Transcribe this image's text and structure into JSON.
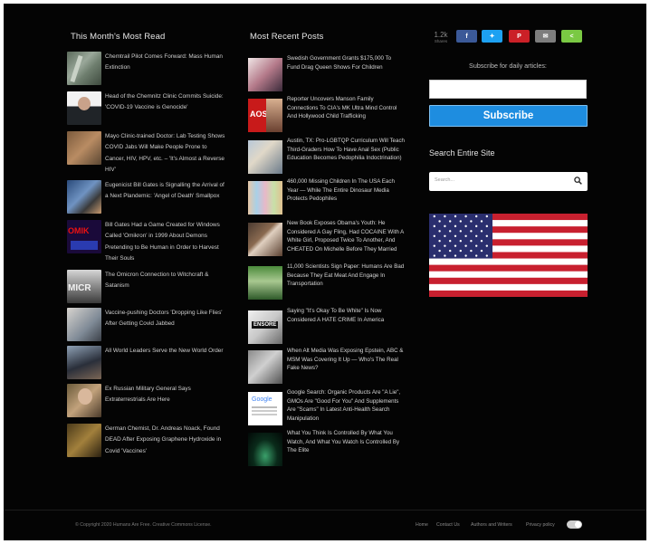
{
  "most_read": {
    "heading": "This Month's Most Read",
    "items": [
      {
        "title": "Chemtrail Pilot Comes Forward: Mass Human Extinction",
        "thumb": "t-chem"
      },
      {
        "title": " Head of the Chemnitz Clinic Commits Suicide: 'COVID-19 Vaccine is Genocide'",
        "thumb": "t-doc"
      },
      {
        "title": "Mayo Clinic-trained Doctor: Lab Testing Shows COVID Jabs Will Make People Prone to Cancer, HIV, HPV, etc. – 'It's Almost a Reverse HIV'",
        "thumb": "t-lab"
      },
      {
        "title": " Eugenicist Bill Gates is Signalling the Arrival of a Next Plandemic: 'Angel of Death' Smallpox",
        "thumb": "t-gates"
      },
      {
        "title": "Bill Gates Had a Game Created for Windows Called 'Omikron' in 1999 About Demons Pretending to Be Human in Order to Harvest Their Souls",
        "thumb": "t-omik"
      },
      {
        "title": " The Omicron Connection to Witchcraft & Satanism",
        "thumb": "t-micro"
      },
      {
        "title": " Vaccine-pushing Doctors 'Dropping Like Flies' After Getting Covid Jabbed",
        "thumb": "t-vax"
      },
      {
        "title": " All World Leaders Serve the New World Order",
        "thumb": "t-lead"
      },
      {
        "title": " Ex Russian Military General Says Extraterrestrials Are Here",
        "thumb": "t-gen"
      },
      {
        "title": " German Chemist, Dr. Andreas Noack, Found DEAD After Exposing Graphene Hydroxide in Covid 'Vaccines'",
        "thumb": "t-noack"
      }
    ]
  },
  "recent_posts": {
    "heading": "Most Recent Posts",
    "items": [
      {
        "title": "Swedish Government Grants $175,000 To Fund Drag Queen Shows For Children",
        "thumb": "t-drag"
      },
      {
        "title": "Reporter Uncovers Manson Family Connections To CIA's MK Ultra Mind Control And Hollywood Child Trafficking",
        "thumb": "t-aos"
      },
      {
        "title": "Austin, TX: Pro-LGBTQP Curriculum Will Teach Third-Graders How To Have Anal Sex (Public Education Becomes Pedophilia Indoctrination)",
        "thumb": "t-school"
      },
      {
        "title": "460,000 Missing Children In The USA Each Year — While The Entire Dinosaur Media Protects Pedophiles",
        "thumb": "t-kids"
      },
      {
        "title": "New Book Exposes Obama's Youth: He Considered A Gay Fling, Had COCAINE With A White Girl, Proposed Twice To Another, And CHEATED On Michelle Before They Married",
        "thumb": "t-obama"
      },
      {
        "title": "11,000 Scientists Sign Paper: Humans Are Bad Because They Eat Meat And Engage In Transportation",
        "thumb": "t-sci"
      },
      {
        "title": "Saying \"It's Okay To Be White\" Is Now Considered A HATE CRIME In America",
        "thumb": "t-okay"
      },
      {
        "title": "When Alt Media Was Exposing Epstein, ABC & MSM Was Covering It Up — Who's The Real Fake News?",
        "thumb": "t-epstein"
      },
      {
        "title": "Google Search: Organic Products Are \"A Lie\", GMOs Are \"Good For You\" And Supplements Are \"Scams\" In Latest Anti-Health Search Manipulation",
        "thumb": "t-google"
      },
      {
        "title": "What You Think Is Controlled By What You Watch, And What You Watch Is Controlled By The Elite",
        "thumb": "t-tv"
      }
    ]
  },
  "sidebar": {
    "share_count": "1.2k",
    "share_label": "Shares",
    "share_buttons": [
      {
        "name": "facebook",
        "glyph": "f"
      },
      {
        "name": "twitter",
        "glyph": "✦"
      },
      {
        "name": "pinterest",
        "glyph": "P"
      },
      {
        "name": "email",
        "glyph": "✉"
      },
      {
        "name": "share",
        "glyph": "<"
      }
    ],
    "subscribe_label": "Subscribe for daily articles:",
    "email_value": "",
    "subscribe_button": "Subscribe",
    "search_title": "Search Entire Site",
    "search_placeholder": "Search..."
  },
  "footer": {
    "copyright": "© Copyright 2020 Humans Are Free. Creative Commons License.",
    "links": [
      "Home",
      "Contact Us",
      "Authors and Writers",
      "Privacy policy"
    ]
  },
  "colors": {
    "background": "#040404",
    "subscribe": "#1e8de0",
    "facebook": "#3b5998",
    "twitter": "#1da1f2",
    "pinterest": "#cb2027",
    "email": "#7d7d7d",
    "share": "#7ac943"
  }
}
